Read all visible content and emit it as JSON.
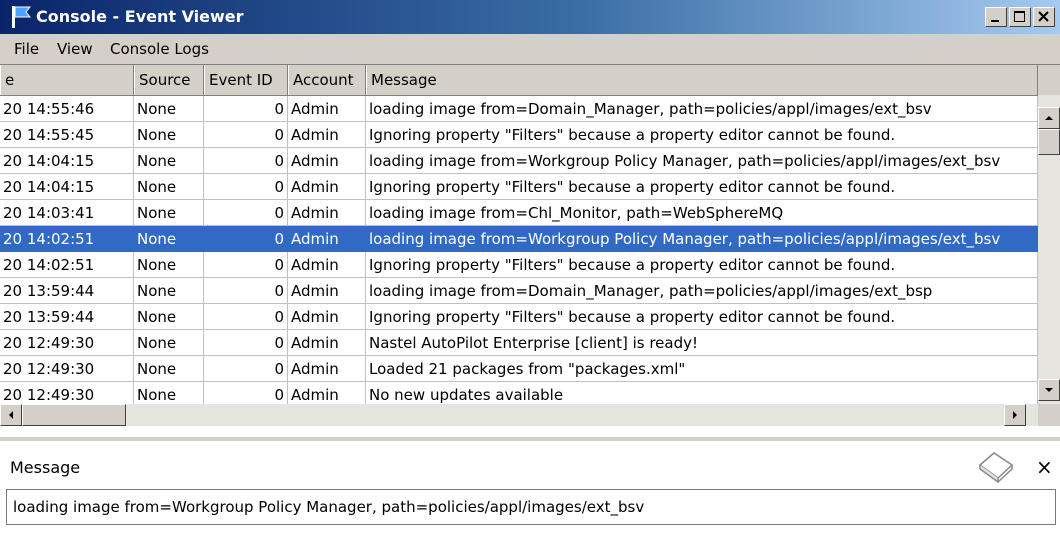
{
  "window": {
    "title": "Console - Event Viewer",
    "controls": {
      "minimize": "minimize",
      "maximize": "maximize",
      "close": "close"
    }
  },
  "menu": [
    "File",
    "View",
    "Console Logs"
  ],
  "table": {
    "columns": [
      "e",
      "Source",
      "Event ID",
      "Account",
      "Message"
    ],
    "selected_index": 5,
    "rows": [
      {
        "time": "20 14:55:46",
        "source": "None",
        "event_id": "0",
        "account": "Admin",
        "message": "loading image from=Domain_Manager, path=policies/appl/images/ext_bsv"
      },
      {
        "time": "20 14:55:45",
        "source": "None",
        "event_id": "0",
        "account": "Admin",
        "message": "Ignoring property \"Filters\" because a property editor cannot be found."
      },
      {
        "time": "20 14:04:15",
        "source": "None",
        "event_id": "0",
        "account": "Admin",
        "message": "loading image from=Workgroup Policy Manager, path=policies/appl/images/ext_bsv"
      },
      {
        "time": "20 14:04:15",
        "source": "None",
        "event_id": "0",
        "account": "Admin",
        "message": "Ignoring property \"Filters\" because a property editor cannot be found."
      },
      {
        "time": "20 14:03:41",
        "source": "None",
        "event_id": "0",
        "account": "Admin",
        "message": "loading image from=Chl_Monitor, path=WebSphereMQ"
      },
      {
        "time": "20 14:02:51",
        "source": "None",
        "event_id": "0",
        "account": "Admin",
        "message": "loading image from=Workgroup Policy Manager, path=policies/appl/images/ext_bsv"
      },
      {
        "time": "20 14:02:51",
        "source": "None",
        "event_id": "0",
        "account": "Admin",
        "message": "Ignoring property \"Filters\" because a property editor cannot be found."
      },
      {
        "time": "20 13:59:44",
        "source": "None",
        "event_id": "0",
        "account": "Admin",
        "message": "loading image from=Domain_Manager, path=policies/appl/images/ext_bsp"
      },
      {
        "time": "20 13:59:44",
        "source": "None",
        "event_id": "0",
        "account": "Admin",
        "message": "Ignoring property \"Filters\" because a property editor cannot be found."
      },
      {
        "time": "20 12:49:30",
        "source": "None",
        "event_id": "0",
        "account": "Admin",
        "message": "Nastel AutoPilot Enterprise [client] is ready!"
      },
      {
        "time": "20 12:49:30",
        "source": "None",
        "event_id": "0",
        "account": "Admin",
        "message": "Loaded 21 packages from \"packages.xml\""
      },
      {
        "time": "20 12:49:30",
        "source": "None",
        "event_id": "0",
        "account": "Admin",
        "message": "No new updates available"
      }
    ]
  },
  "detail": {
    "label": "Message",
    "text": "loading image from=Workgroup Policy Manager, path=policies/appl/images/ext_bsv",
    "icon": "eraser-icon",
    "close": "×"
  },
  "colors": {
    "selection": "#316ac5",
    "titlebar_start": "#0a246a",
    "titlebar_end": "#a6caf0",
    "chrome": "#d4d0c8"
  }
}
